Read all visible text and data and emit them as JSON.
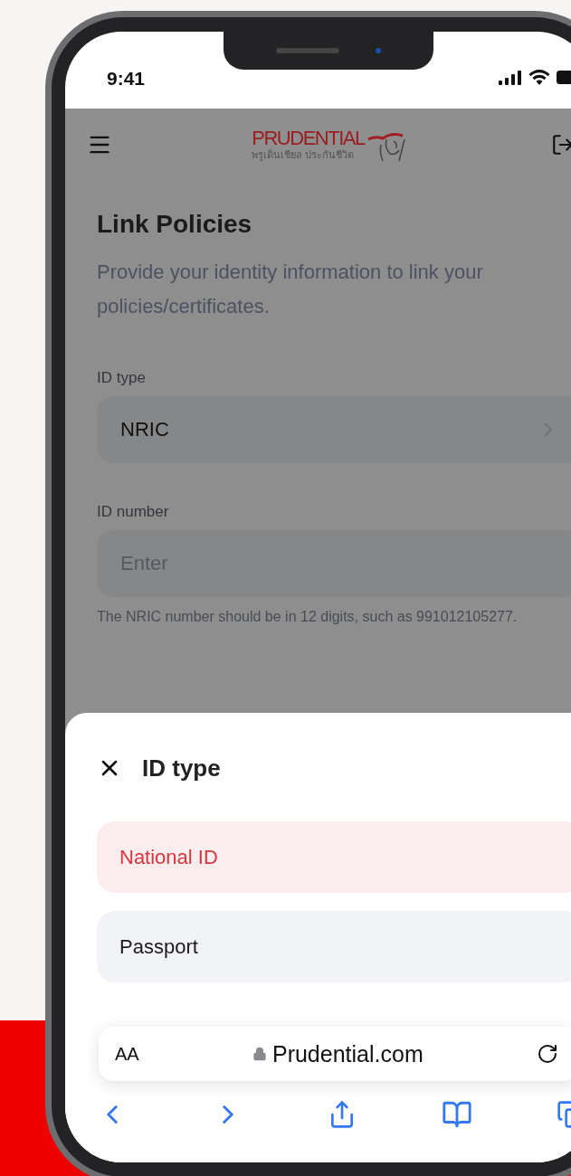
{
  "status_bar": {
    "time": "9:41"
  },
  "header": {
    "logo_text": "PRUDENTIAL",
    "logo_subtext": "พรูเด็นเชียล ประกันชีวิต"
  },
  "page": {
    "title": "Link Policies",
    "description": "Provide your identity information to link your policies/certificates.",
    "fields": [
      {
        "kind": "select",
        "label": "ID type",
        "value": "NRIC"
      },
      {
        "kind": "input",
        "label": "ID number",
        "placeholder": "Enter",
        "hint": "The NRIC number should be in 12 digits, such as 991012105277."
      }
    ]
  },
  "sheet": {
    "title": "ID type",
    "options": [
      {
        "label": "National ID",
        "selected": true
      },
      {
        "label": "Passport",
        "selected": false
      }
    ]
  },
  "browser": {
    "text_size": "AA",
    "url": "Prudential.com"
  }
}
